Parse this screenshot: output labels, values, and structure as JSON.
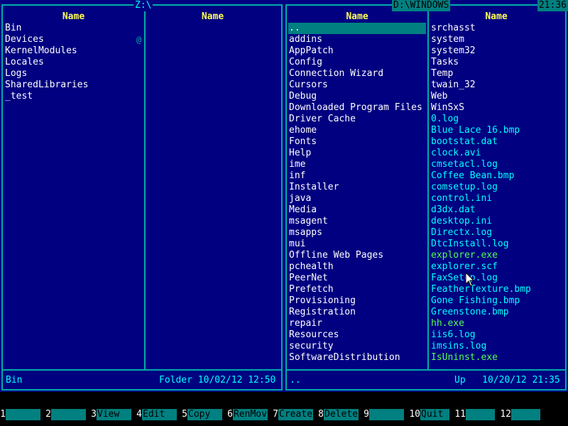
{
  "left_panel": {
    "path": "Z:\\",
    "col1_header": "Name",
    "col2_header": "Name",
    "col1_items": [
      "Bin",
      "Devices",
      "KernelModules",
      "Locales",
      "Logs",
      "SharedLibraries",
      "_test"
    ],
    "mark_text": "@",
    "status_name": "Bin",
    "status_info": "Folder 10/02/12 12:50"
  },
  "right_panel": {
    "path": "D:\\WINDOWS",
    "col1_header": "Name",
    "col2_header": "Name",
    "col1_items": [
      "..",
      "addins",
      "AppPatch",
      "Config",
      "Connection Wizard",
      "Cursors",
      "Debug",
      "Downloaded Program Files",
      "Driver Cache",
      "ehome",
      "Fonts",
      "Help",
      "ime",
      "inf",
      "Installer",
      "java",
      "Media",
      "msagent",
      "msapps",
      "mui",
      "Offline Web Pages",
      "pchealth",
      "PeerNet",
      "Prefetch",
      "Provisioning",
      "Registration",
      "repair",
      "Resources",
      "security",
      "SoftwareDistribution"
    ],
    "col2_items": [
      {
        "name": "srchasst",
        "kind": "dir"
      },
      {
        "name": "system",
        "kind": "dir"
      },
      {
        "name": "system32",
        "kind": "dir"
      },
      {
        "name": "Tasks",
        "kind": "dir"
      },
      {
        "name": "Temp",
        "kind": "dir"
      },
      {
        "name": "twain_32",
        "kind": "dir"
      },
      {
        "name": "Web",
        "kind": "dir"
      },
      {
        "name": "WinSxS",
        "kind": "dir"
      },
      {
        "name": "0.log",
        "kind": "file"
      },
      {
        "name": "Blue Lace 16.bmp",
        "kind": "file"
      },
      {
        "name": "bootstat.dat",
        "kind": "file"
      },
      {
        "name": "clock.avi",
        "kind": "file"
      },
      {
        "name": "cmsetacl.log",
        "kind": "file"
      },
      {
        "name": "Coffee Bean.bmp",
        "kind": "file"
      },
      {
        "name": "comsetup.log",
        "kind": "file"
      },
      {
        "name": "control.ini",
        "kind": "file"
      },
      {
        "name": "d3dx.dat",
        "kind": "file"
      },
      {
        "name": "desktop.ini",
        "kind": "file"
      },
      {
        "name": "Directx.log",
        "kind": "file"
      },
      {
        "name": "DtcInstall.log",
        "kind": "file"
      },
      {
        "name": "explorer.exe",
        "kind": "exe"
      },
      {
        "name": "explorer.scf",
        "kind": "file"
      },
      {
        "name": "FaxSetup.log",
        "kind": "file"
      },
      {
        "name": "FeatherTexture.bmp",
        "kind": "file"
      },
      {
        "name": "Gone Fishing.bmp",
        "kind": "file"
      },
      {
        "name": "Greenstone.bmp",
        "kind": "file"
      },
      {
        "name": "hh.exe",
        "kind": "exe"
      },
      {
        "name": "iis6.log",
        "kind": "file"
      },
      {
        "name": "imsins.log",
        "kind": "file"
      },
      {
        "name": "IsUninst.exe",
        "kind": "exe"
      }
    ],
    "status_name": "..",
    "status_info": "Up   10/20/12 21:35"
  },
  "clock": "21:36",
  "function_keys": [
    {
      "num": "1",
      "label": ""
    },
    {
      "num": "2",
      "label": ""
    },
    {
      "num": "3",
      "label": "View"
    },
    {
      "num": "4",
      "label": "Edit"
    },
    {
      "num": "5",
      "label": "Copy"
    },
    {
      "num": "6",
      "label": "RenMov"
    },
    {
      "num": "7",
      "label": "Create"
    },
    {
      "num": "8",
      "label": "Delete"
    },
    {
      "num": "9",
      "label": ""
    },
    {
      "num": "10",
      "label": "Quit"
    },
    {
      "num": "11",
      "label": ""
    },
    {
      "num": "12",
      "label": ""
    }
  ],
  "colors": {
    "panel_bg": "#000080",
    "border": "#00aaaa",
    "header": "#ffff55",
    "selection": "#008080",
    "exe": "#55ff55"
  }
}
